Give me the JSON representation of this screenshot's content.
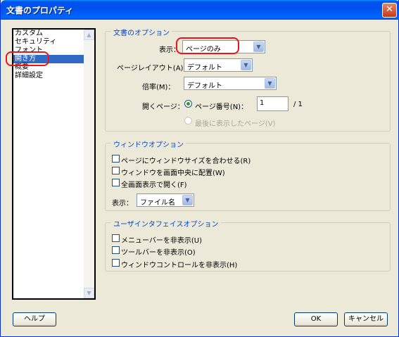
{
  "window": {
    "title": "文書のプロパティ",
    "close_label": "✕"
  },
  "sidebar": {
    "items": [
      {
        "label": "カスタム",
        "selected": false
      },
      {
        "label": "セキュリティ",
        "selected": false
      },
      {
        "label": "フォント",
        "selected": false
      },
      {
        "label": "開き方",
        "selected": true
      },
      {
        "label": "概要",
        "selected": false
      },
      {
        "label": "詳細設定",
        "selected": false
      }
    ]
  },
  "doc_options": {
    "legend": "文書のオプション",
    "display_label": "表示：",
    "display_value": "ページのみ",
    "page_layout_label": "ページレイアウト(A)：",
    "page_layout_value": "デフォルト",
    "magnification_label": "倍率(M)：",
    "magnification_value": "デフォルト",
    "open_page_label": "開くページ：",
    "page_number_label": "ページ番号(N)：",
    "page_number_value": "1",
    "page_total": "/ 1",
    "last_viewed_label": "最後に表示したページ(V)"
  },
  "window_options": {
    "legend": "ウィンドウオプション",
    "fit_window_label": "ページにウィンドウサイズを合わせる(R)",
    "center_window_label": "ウィンドウを画面中央に配置(W)",
    "fullscreen_label": "全画面表示で開く(F)",
    "show_label": "表示：",
    "show_value": "ファイル名"
  },
  "ui_options": {
    "legend": "ユーザインタフェイスオプション",
    "hide_menubar_label": "メニューバーを非表示(U)",
    "hide_toolbar_label": "ツールバーを非表示(O)",
    "hide_window_controls_label": "ウィンドウコントロールを非表示(H)"
  },
  "footer": {
    "help_label": "ヘルプ",
    "ok_label": "OK",
    "cancel_label": "キャンセル"
  },
  "colors": {
    "titlebar": "#0054e3",
    "highlight_ring": "#e8141e",
    "selection": "#316ac5",
    "group_legend": "#0046d5"
  }
}
